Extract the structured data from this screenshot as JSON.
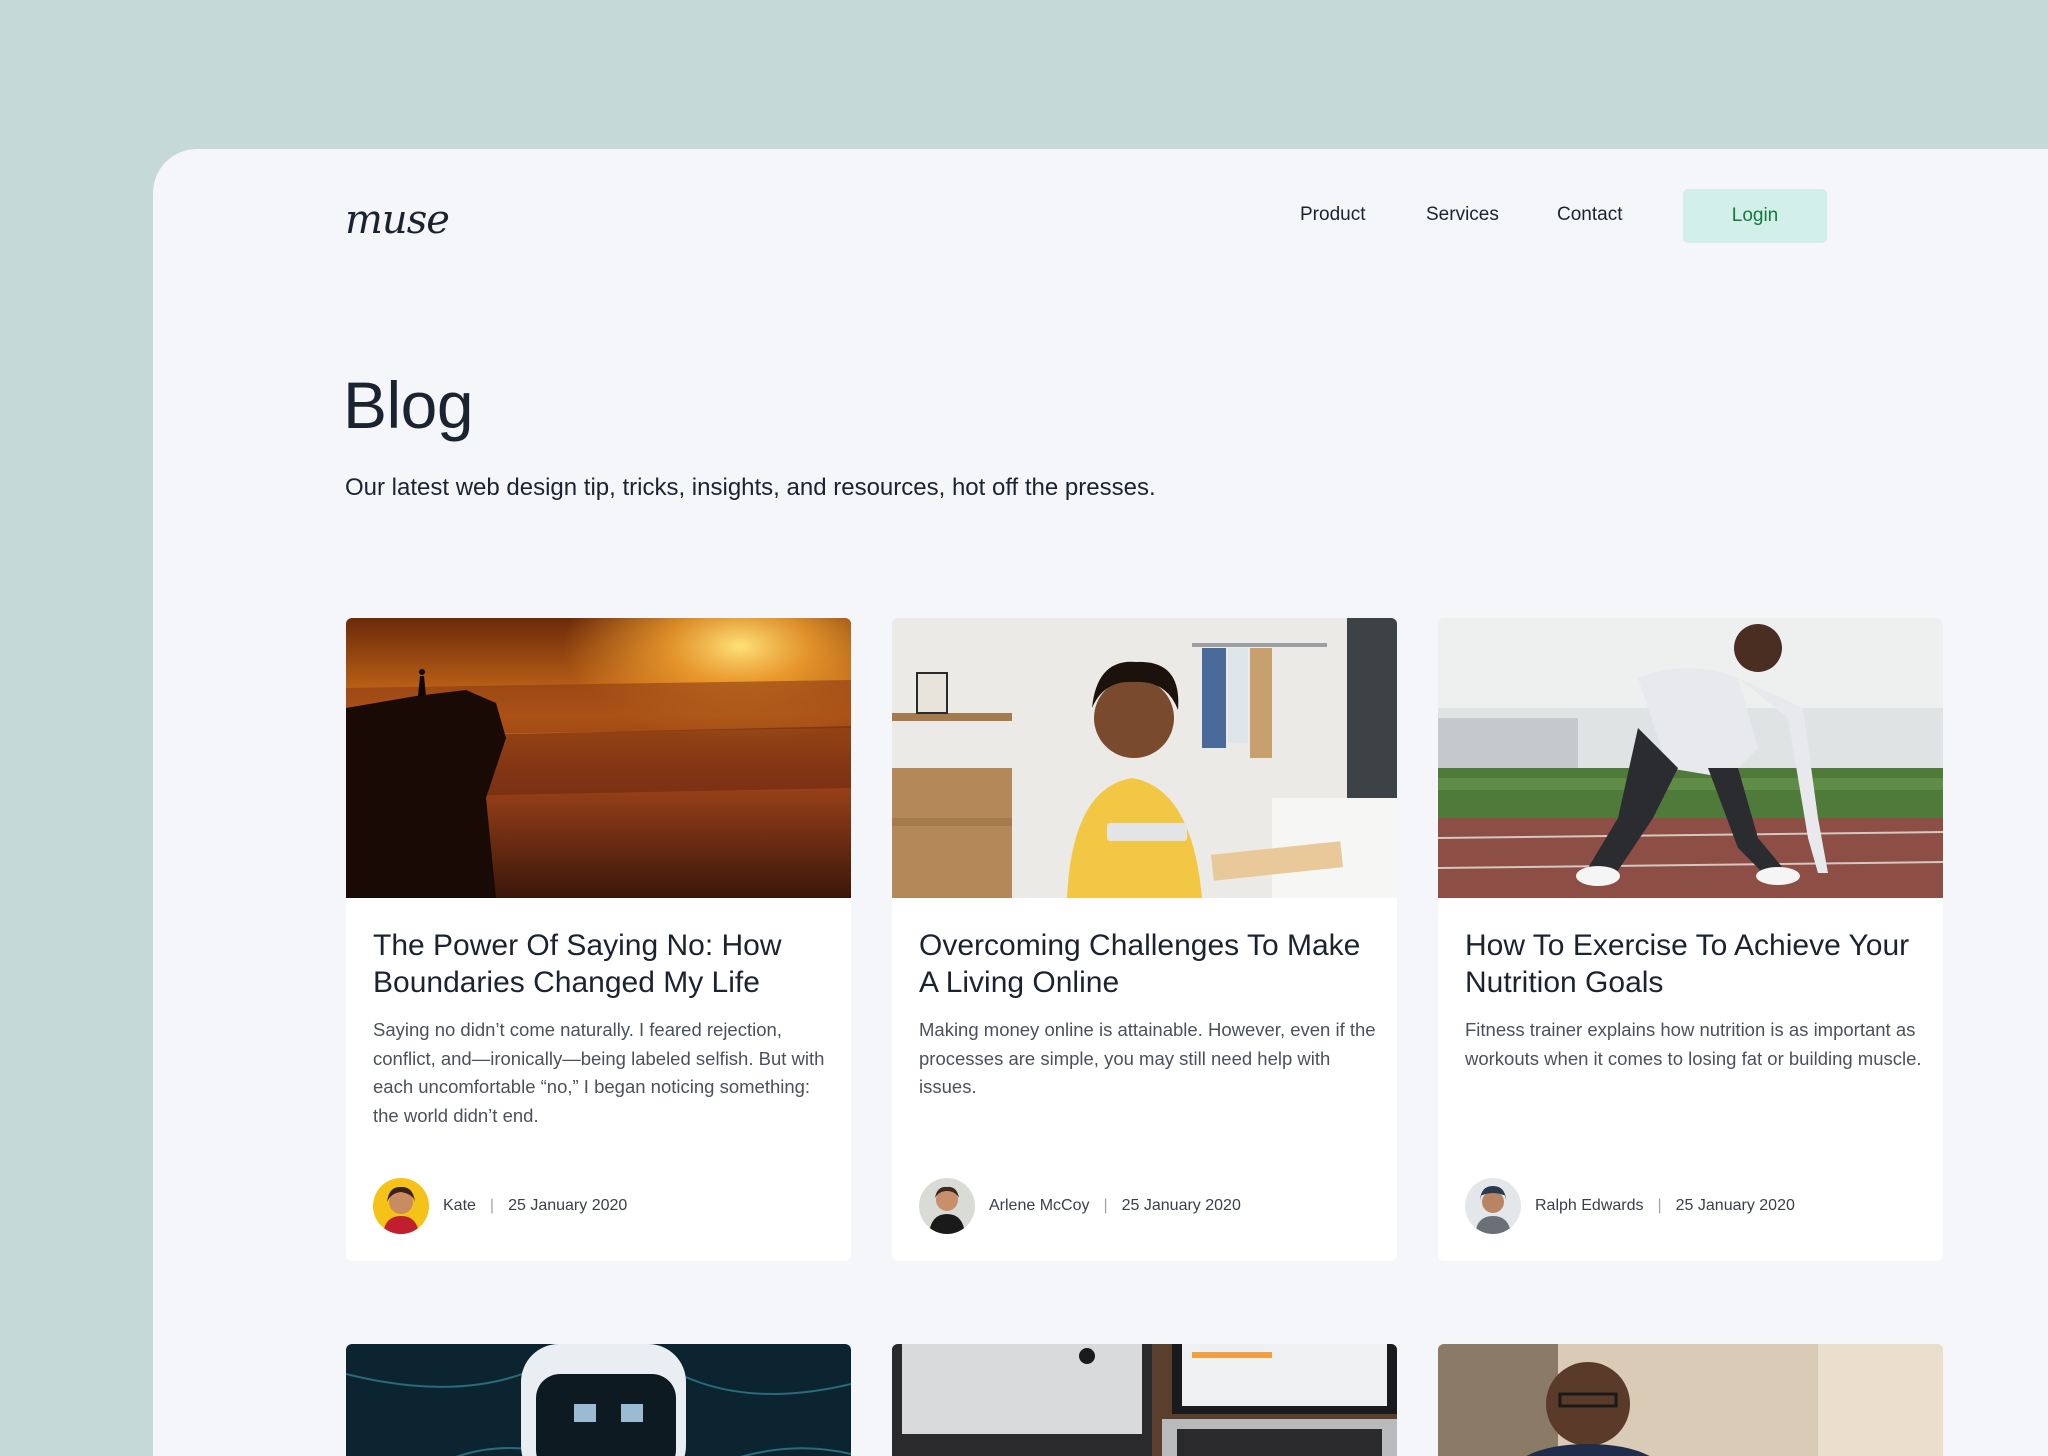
{
  "brand": {
    "logo_text": "muse"
  },
  "nav": {
    "items": [
      "Product",
      "Services",
      "Contact"
    ],
    "login_label": "Login"
  },
  "hero": {
    "title": "Blog",
    "subtitle": "Our latest web design tip, tricks, insights, and resources, hot off the presses."
  },
  "posts": [
    {
      "title": "The Power Of Saying No: How Boundaries Changed My Life",
      "excerpt": "Saying no didn’t come naturally. I feared rejection, conflict, and—ironically—being labeled selfish. But with each uncomfortable “no,” I began noticing something: the world didn’t end.",
      "author": "Kate",
      "date": "25 January 2020",
      "image": "sunset-cliff-photo"
    },
    {
      "title": "Overcoming Challenges To Make A Living Online",
      "excerpt": "Making money online is attainable. However, even if the processes are simple, you may still need help with issues.",
      "author": "Arlene McCoy",
      "date": "25 January 2020",
      "image": "teen-with-tablet-photo"
    },
    {
      "title": "How To Exercise To Achieve Your Nutrition Goals",
      "excerpt": "Fitness trainer explains how nutrition is as important as workouts when it comes to losing fat or building muscle.",
      "author": "Ralph Edwards",
      "date": "25 January 2020",
      "image": "sprinter-start-photo"
    }
  ],
  "more_posts": [
    {
      "image": "robot-photo"
    },
    {
      "image": "desk-computers-photo"
    },
    {
      "image": "man-with-glasses-photo"
    }
  ],
  "colors": {
    "backdrop": "#c5dad6",
    "page": "#f4f6f9",
    "login_bg": "#d2efe9",
    "login_text": "#137a3d",
    "text": "#1c2330"
  }
}
